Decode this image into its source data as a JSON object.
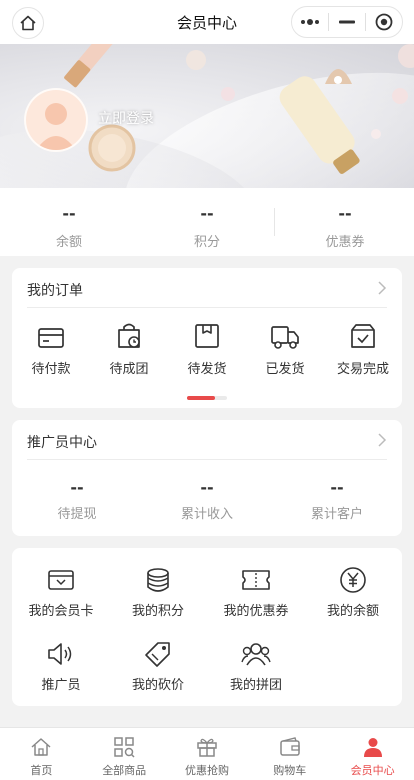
{
  "nav": {
    "title": "会员中心",
    "home_icon": "home-icon",
    "more_icon": "more-dots-icon",
    "minimize_icon": "minimize-icon",
    "close_icon": "target-close-icon"
  },
  "banner": {
    "login_label": "立即登录",
    "avatar_icon": "user-avatar-icon"
  },
  "stats": [
    {
      "value": "--",
      "label": "余额"
    },
    {
      "value": "--",
      "label": "积分"
    },
    {
      "value": "--",
      "label": "优惠券"
    }
  ],
  "orders": {
    "title": "我的订单",
    "items": [
      {
        "label": "待付款",
        "icon": "wallet-card-icon"
      },
      {
        "label": "待成团",
        "icon": "bag-clock-icon"
      },
      {
        "label": "待发货",
        "icon": "package-box-icon"
      },
      {
        "label": "已发货",
        "icon": "truck-icon"
      },
      {
        "label": "交易完成",
        "icon": "box-check-icon"
      }
    ],
    "active_index": 2,
    "accent_color": "#e84a4a"
  },
  "promoter": {
    "title": "推广员中心",
    "items": [
      {
        "value": "--",
        "label": "待提现"
      },
      {
        "value": "--",
        "label": "累计收入"
      },
      {
        "value": "--",
        "label": "累计客户"
      }
    ]
  },
  "tools": [
    {
      "label": "我的会员卡",
      "icon": "member-card-icon"
    },
    {
      "label": "我的积分",
      "icon": "coins-stack-icon"
    },
    {
      "label": "我的优惠券",
      "icon": "coupon-ticket-icon"
    },
    {
      "label": "我的余额",
      "icon": "yen-circle-icon"
    },
    {
      "label": "推广员",
      "icon": "speaker-icon"
    },
    {
      "label": "我的砍价",
      "icon": "price-tag-icon"
    },
    {
      "label": "我的拼团",
      "icon": "group-users-icon"
    }
  ],
  "tabbar": {
    "items": [
      {
        "label": "首页",
        "icon": "home-icon"
      },
      {
        "label": "全部商品",
        "icon": "grid-search-icon"
      },
      {
        "label": "优惠抢购",
        "icon": "gift-icon"
      },
      {
        "label": "购物车",
        "icon": "cart-wallet-icon"
      },
      {
        "label": "会员中心",
        "icon": "person-icon"
      }
    ],
    "active_index": 4,
    "active_color": "#e84a4a"
  }
}
